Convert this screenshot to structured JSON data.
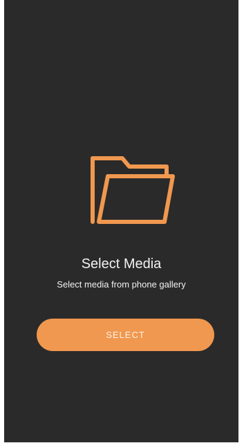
{
  "colors": {
    "background": "#2a2a2a",
    "accent": "#f0984f",
    "text": "#f2f2f2"
  },
  "empty_state": {
    "icon": "folder-open-icon",
    "title": "Select Media",
    "subtitle": "Select media from phone gallery"
  },
  "actions": {
    "select_label": "SELECT"
  }
}
